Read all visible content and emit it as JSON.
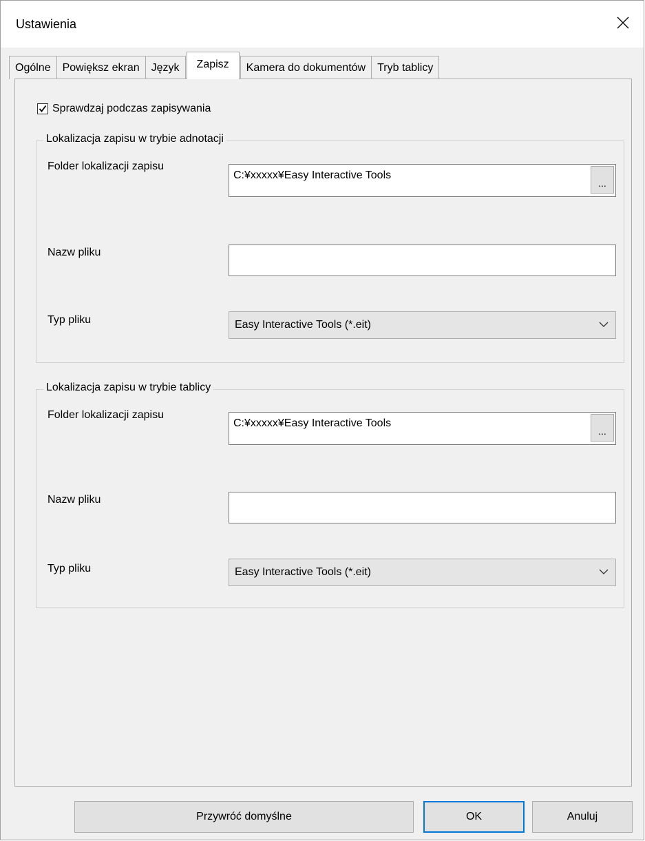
{
  "window": {
    "title": "Ustawienia"
  },
  "tabs": [
    {
      "label": "Ogólne"
    },
    {
      "label": "Powiększ ekran"
    },
    {
      "label": "Język"
    },
    {
      "label": "Zapisz"
    },
    {
      "label": "Kamera do dokumentów"
    },
    {
      "label": "Tryb tablicy"
    }
  ],
  "active_tab": "Zapisz",
  "save_tab": {
    "check_on_save": {
      "label": "Sprawdzaj podczas zapisywania",
      "checked": true
    },
    "annotation_group": {
      "title": "Lokalizacja zapisu w trybie adnotacji",
      "folder_label": "Folder lokalizacji zapisu",
      "folder_value": "C:¥xxxxx¥Easy Interactive Tools",
      "browse_label": "...",
      "filename_label": "Nazw pliku",
      "filename_value": "",
      "filetype_label": "Typ pliku",
      "filetype_value": "Easy Interactive Tools (*.eit)"
    },
    "whiteboard_group": {
      "title": "Lokalizacja zapisu w trybie tablicy",
      "folder_label": "Folder lokalizacji zapisu",
      "folder_value": "C:¥xxxxx¥Easy Interactive Tools",
      "browse_label": "...",
      "filename_label": "Nazw pliku",
      "filename_value": "",
      "filetype_label": "Typ pliku",
      "filetype_value": "Easy Interactive Tools (*.eit)"
    }
  },
  "buttons": {
    "restore_defaults": "Przywróć domyślne",
    "ok": "OK",
    "cancel": "Anuluj"
  },
  "colors": {
    "focus_border": "#0078d7",
    "panel_bg": "#f0f0f0"
  }
}
